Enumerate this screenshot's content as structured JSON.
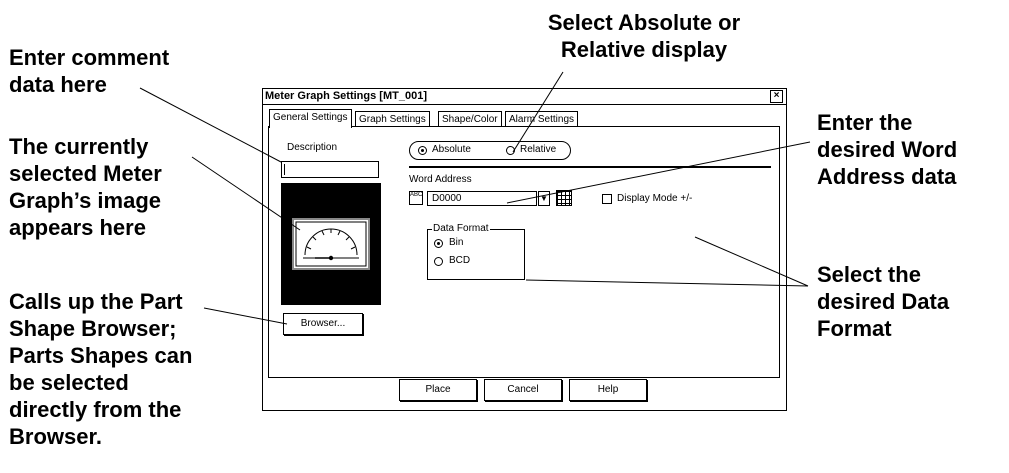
{
  "callouts": {
    "comment": "Enter comment\ndata here",
    "image": "The currently\nselected Meter\nGraph’s image\nappears here",
    "browser": "Calls up the Part\nShape Browser;\nParts Shapes can\nbe selected\ndirectly from the\nBrowser.",
    "absolute_relative": "Select Absolute or\nRelative display",
    "word_address": "Enter the\ndesired Word\nAddress data",
    "data_format": "Select the\ndesired Data\nFormat"
  },
  "dialog": {
    "title": "Meter Graph Settings [MT_001]",
    "close_glyph": "×",
    "tabs": [
      {
        "label": "General Settings",
        "active": true
      },
      {
        "label": "Graph Settings",
        "active": false
      },
      {
        "label": "Shape/Color",
        "active": false
      },
      {
        "label": "Alarm Settings",
        "active": false
      }
    ],
    "description_label": "Description",
    "description_value": "",
    "browser_button": "Browser...",
    "display_mode": {
      "options": [
        "Absolute",
        "Relative"
      ],
      "selected": "Absolute"
    },
    "word_address_label": "Word Address",
    "word_address_value": "D0000",
    "word_address_icon_text": "ABC",
    "display_mode_pm_label": "Display Mode +/-",
    "display_mode_pm_checked": false,
    "data_format": {
      "legend": "Data Format",
      "options": [
        "Bin",
        "BCD"
      ],
      "selected": "Bin"
    },
    "buttons": {
      "place": "Place",
      "cancel": "Cancel",
      "help": "Help"
    }
  }
}
